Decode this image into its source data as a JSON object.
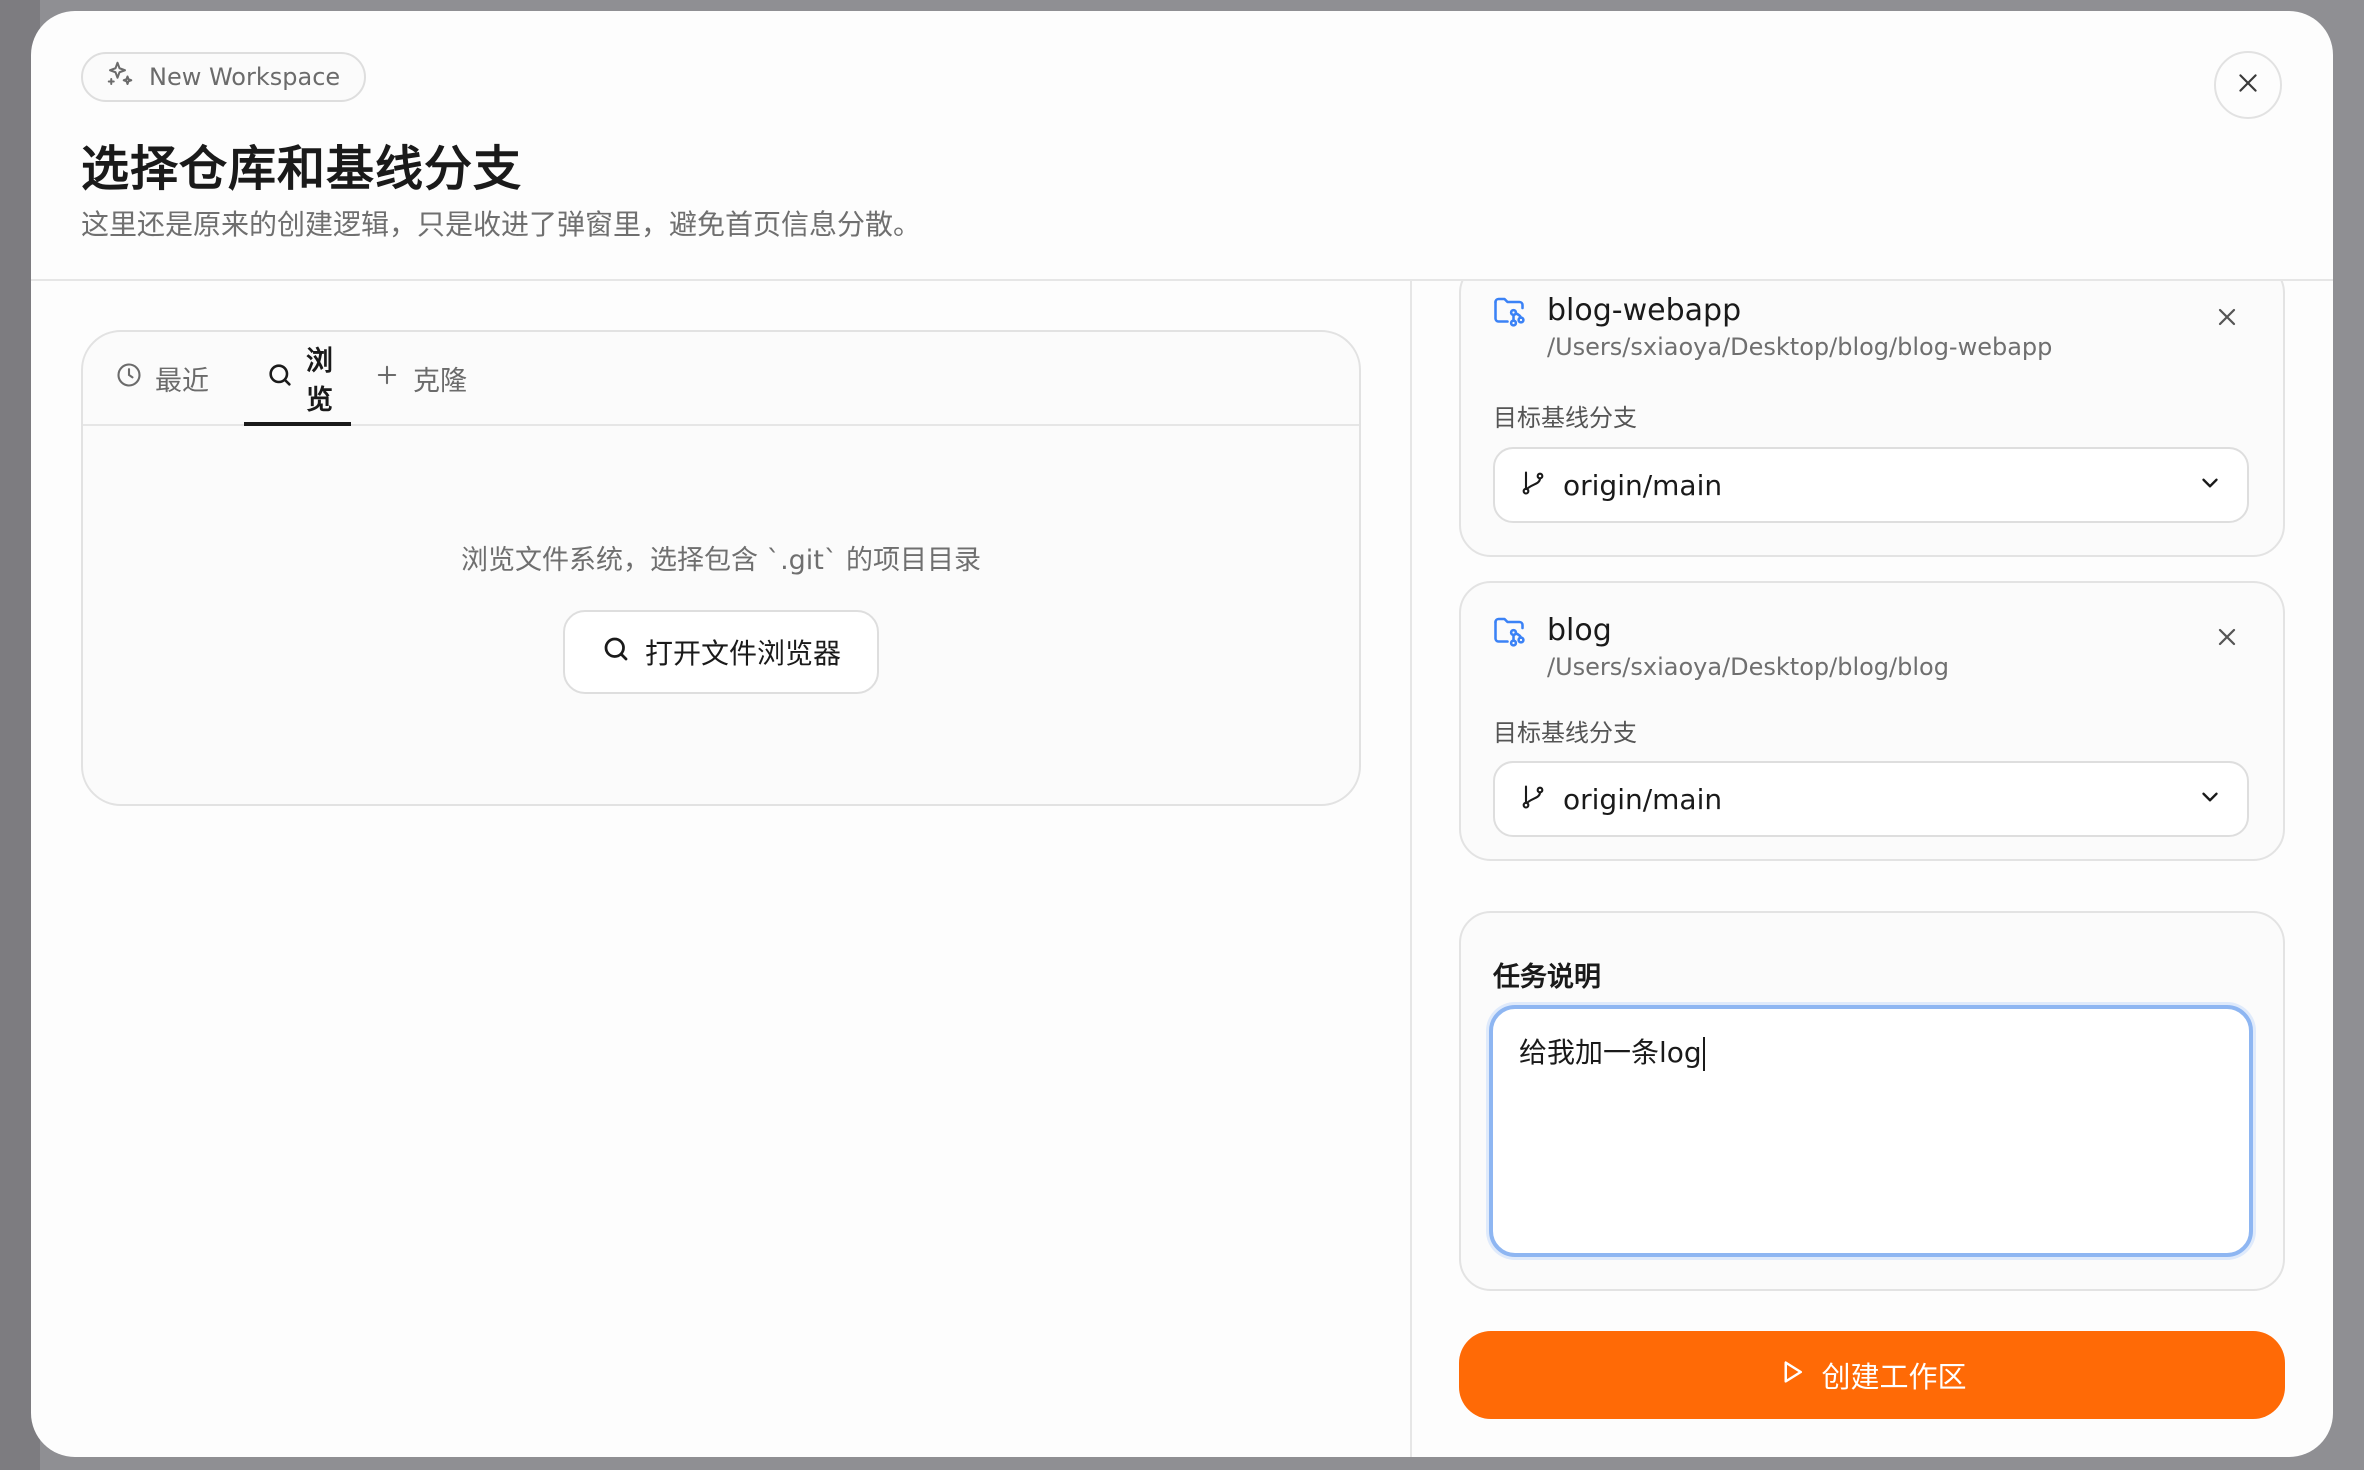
{
  "header": {
    "badge_label": "New Workspace",
    "title": "选择仓库和基线分支",
    "subtitle": "这里还是原来的创建逻辑，只是收进了弹窗里，避免首页信息分散。"
  },
  "tabs": [
    {
      "label": "最近",
      "icon": "clock-icon",
      "active": false
    },
    {
      "label": "浏览",
      "icon": "search-icon",
      "active": true
    },
    {
      "label": "克隆",
      "icon": "plus-icon",
      "active": false
    }
  ],
  "browse": {
    "hint": "浏览文件系统，选择包含 `.git` 的项目目录",
    "open_button_label": "打开文件浏览器"
  },
  "repos": [
    {
      "name": "blog-webapp",
      "path": "/Users/sxiaoya/Desktop/blog/blog-webapp",
      "branch_label": "目标基线分支",
      "branch": "origin/main"
    },
    {
      "name": "blog",
      "path": "/Users/sxiaoya/Desktop/blog/blog",
      "branch_label": "目标基线分支",
      "branch": "origin/main"
    }
  ],
  "task": {
    "label": "任务说明",
    "value": "给我加一条log"
  },
  "create_button_label": "创建工作区",
  "colors": {
    "accent": "#ff6a06",
    "focus_ring": "#8eb6f2",
    "folder_icon": "#3b82f6"
  }
}
